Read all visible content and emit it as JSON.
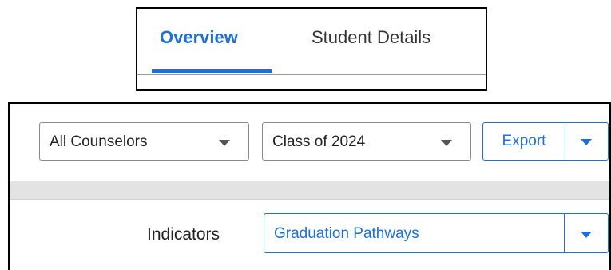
{
  "tabs": [
    {
      "label": "Overview",
      "active": true
    },
    {
      "label": "Student Details",
      "active": false
    }
  ],
  "filters": {
    "counselor": {
      "value": "All Counselors",
      "icon": "chevron-down-icon"
    },
    "class_year": {
      "value": "Class of 2024",
      "icon": "chevron-down-icon"
    }
  },
  "export": {
    "label": "Export",
    "dropdown_icon": "chevron-down-icon"
  },
  "indicators": {
    "label": "Indicators",
    "value": "Graduation Pathways",
    "icon": "chevron-down-icon"
  },
  "colors": {
    "accent": "#1f6fd6",
    "band": "#e3e3e3",
    "border": "#8a8a8a"
  }
}
